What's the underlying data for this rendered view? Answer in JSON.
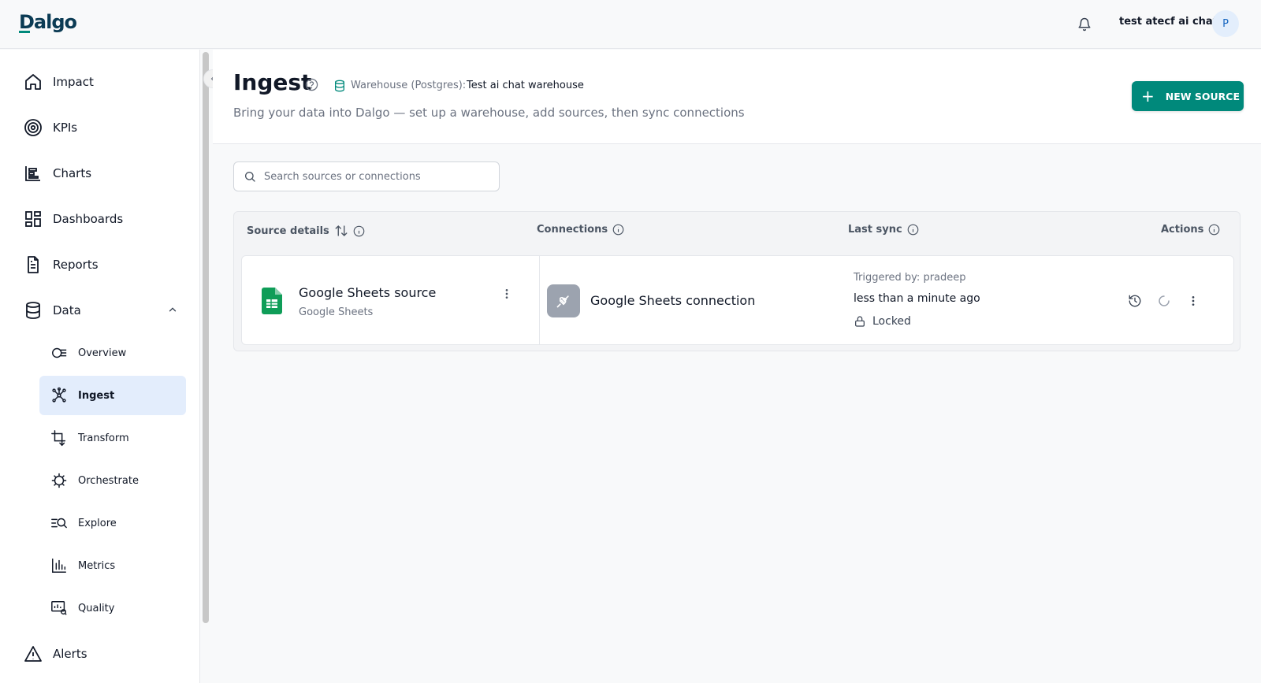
{
  "app": {
    "logo": "Dalgo",
    "username": "test atecf ai chat",
    "avatar_initial": "P",
    "accent": "#00897b"
  },
  "sidebar": {
    "items": [
      {
        "label": "Impact",
        "icon": "home-icon"
      },
      {
        "label": "KPIs",
        "icon": "target-icon"
      },
      {
        "label": "Charts",
        "icon": "bar-chart-icon"
      },
      {
        "label": "Dashboards",
        "icon": "dashboard-icon"
      },
      {
        "label": "Reports",
        "icon": "document-icon"
      },
      {
        "label": "Data",
        "icon": "database-icon",
        "expanded": true
      },
      {
        "label": "Alerts",
        "icon": "warning-icon"
      }
    ],
    "data_children": [
      {
        "label": "Overview",
        "icon": "overview-icon"
      },
      {
        "label": "Ingest",
        "icon": "network-icon",
        "active": true
      },
      {
        "label": "Transform",
        "icon": "transform-icon"
      },
      {
        "label": "Orchestrate",
        "icon": "orchestrate-icon"
      },
      {
        "label": "Explore",
        "icon": "explore-icon"
      },
      {
        "label": "Metrics",
        "icon": "metrics-icon"
      },
      {
        "label": "Quality",
        "icon": "quality-icon"
      }
    ]
  },
  "page": {
    "title": "Ingest",
    "warehouse_label": "Warehouse (Postgres):",
    "warehouse_name": "Test ai chat warehouse",
    "subtitle": "Bring your data into Dalgo — set up a warehouse, add sources, then sync connections",
    "new_source_label": "NEW SOURCE"
  },
  "search": {
    "placeholder": "Search sources or connections",
    "value": ""
  },
  "table": {
    "headers": {
      "source": "Source details",
      "connections": "Connections",
      "last_sync": "Last sync",
      "actions": "Actions"
    },
    "rows": [
      {
        "source_name": "Google Sheets source",
        "source_type": "Google Sheets",
        "connection_name": "Google Sheets connection",
        "triggered_by": "Triggered by: pradeep",
        "last_sync": "less than a minute ago",
        "status": "Locked"
      }
    ]
  }
}
